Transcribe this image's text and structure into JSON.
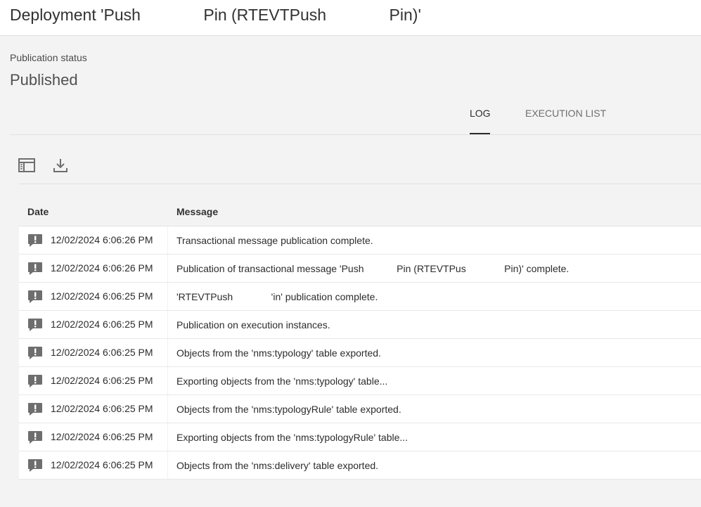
{
  "header": {
    "title": "Deployment 'Push              Pin (RTEVTPush              Pin)'"
  },
  "status": {
    "label": "Publication status",
    "value": "Published"
  },
  "tabs": [
    {
      "label": "LOG",
      "active": true
    },
    {
      "label": "EXECUTION LIST",
      "active": false
    }
  ],
  "toolbar": {
    "buttons": [
      {
        "icon": "panel-toggle-icon"
      },
      {
        "icon": "download-icon"
      }
    ]
  },
  "table": {
    "columns": [
      "Date",
      "Message"
    ],
    "rows": [
      {
        "date": "12/02/2024 6:06:26 PM",
        "message": "Transactional message publication complete."
      },
      {
        "date": "12/02/2024 6:06:26 PM",
        "message": "Publication of transactional message 'Push            Pin (RTEVTPus              Pin)' complete."
      },
      {
        "date": "12/02/2024 6:06:25 PM",
        "message": "'RTEVTPush              'in' publication complete."
      },
      {
        "date": "12/02/2024 6:06:25 PM",
        "message": "Publication on execution instances."
      },
      {
        "date": "12/02/2024 6:06:25 PM",
        "message": "Objects from the 'nms:typology' table exported."
      },
      {
        "date": "12/02/2024 6:06:25 PM",
        "message": "Exporting objects from the 'nms:typology' table..."
      },
      {
        "date": "12/02/2024 6:06:25 PM",
        "message": "Objects from the 'nms:typologyRule' table exported."
      },
      {
        "date": "12/02/2024 6:06:25 PM",
        "message": "Exporting objects from the 'nms:typologyRule' table..."
      },
      {
        "date": "12/02/2024 6:06:25 PM",
        "message": "Objects from the 'nms:delivery' table exported."
      }
    ],
    "row_icon": "alert-bubble-icon"
  },
  "colors": {
    "background": "#f3f3f3",
    "surface": "#ffffff",
    "icon": "#6e6e6e",
    "text": "#2c2c2c"
  }
}
